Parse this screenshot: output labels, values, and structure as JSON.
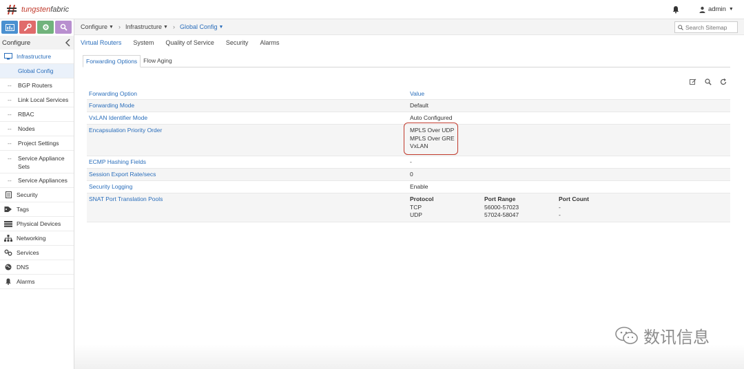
{
  "header": {
    "logo_brand": "tungsten",
    "logo_suffix": "fabric",
    "user": "admin"
  },
  "sidebar": {
    "section_title": "Configure",
    "items": [
      {
        "label": "Infrastructure",
        "icon": "monitor-icon"
      },
      {
        "label": "Global Config"
      },
      {
        "label": "BGP Routers"
      },
      {
        "label": "Link Local Services"
      },
      {
        "label": "RBAC"
      },
      {
        "label": "Nodes"
      },
      {
        "label": "Project Settings"
      },
      {
        "label": "Service Appliance Sets"
      },
      {
        "label": "Service Appliances"
      },
      {
        "label": "Security",
        "icon": "document-icon"
      },
      {
        "label": "Tags",
        "icon": "tag-icon"
      },
      {
        "label": "Physical Devices",
        "icon": "server-icon"
      },
      {
        "label": "Networking",
        "icon": "network-icon"
      },
      {
        "label": "Services",
        "icon": "link-icon"
      },
      {
        "label": "DNS",
        "icon": "globe-icon"
      },
      {
        "label": "Alarms",
        "icon": "bell-icon"
      }
    ]
  },
  "breadcrumb": {
    "items": [
      "Configure",
      "Infrastructure",
      "Global Config"
    ]
  },
  "search": {
    "placeholder": "Search Sitemap"
  },
  "main_tabs": [
    "Virtual Routers",
    "System",
    "Quality of Service",
    "Security",
    "Alarms"
  ],
  "sub_tabs": [
    "Forwarding Options",
    "Flow Aging"
  ],
  "table": {
    "header_key": "Forwarding Option",
    "header_value": "Value",
    "rows": [
      {
        "key": "Forwarding Mode",
        "value": "Default"
      },
      {
        "key": "VxLAN Identifier Mode",
        "value": "Auto Configured"
      },
      {
        "key": "Encapsulation Priority Order",
        "values": [
          "MPLS Over UDP",
          "MPLS Over GRE",
          "VxLAN"
        ]
      },
      {
        "key": "ECMP Hashing Fields",
        "value": "-"
      },
      {
        "key": "Session Export Rate/secs",
        "value": "0"
      },
      {
        "key": "Security Logging",
        "value": "Enable"
      },
      {
        "key": "SNAT Port Translation Pools"
      }
    ],
    "snat": {
      "headers": [
        "Protocol",
        "Port Range",
        "Port Count"
      ],
      "rows": [
        [
          "TCP",
          "56000-57023",
          "-"
        ],
        [
          "UDP",
          "57024-58047",
          "-"
        ]
      ]
    }
  },
  "watermark": "数讯信息",
  "colors": {
    "accent": "#2a6ebb",
    "highlight": "#c0392b"
  }
}
